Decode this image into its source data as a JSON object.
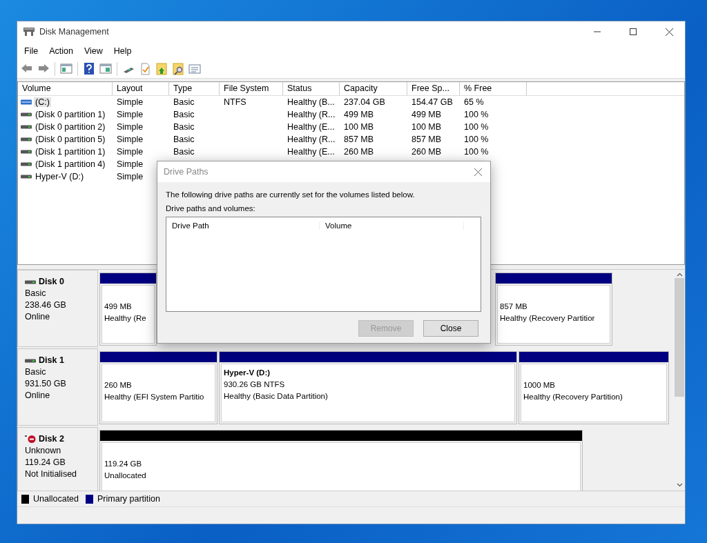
{
  "window": {
    "title": "Disk Management"
  },
  "menu": [
    "File",
    "Action",
    "View",
    "Help"
  ],
  "volume_table": {
    "columns": [
      "Volume",
      "Layout",
      "Type",
      "File System",
      "Status",
      "Capacity",
      "Free Sp...",
      "% Free"
    ],
    "rows": [
      {
        "kind": "system",
        "selected": true,
        "cells": [
          "(C:)",
          "Simple",
          "Basic",
          "NTFS",
          "Healthy (B...",
          "237.04 GB",
          "154.47 GB",
          "65 %"
        ]
      },
      {
        "kind": "plain",
        "selected": false,
        "cells": [
          "(Disk 0 partition 1)",
          "Simple",
          "Basic",
          "",
          "Healthy (R...",
          "499 MB",
          "499 MB",
          "100 %"
        ]
      },
      {
        "kind": "plain",
        "selected": false,
        "cells": [
          "(Disk 0 partition 2)",
          "Simple",
          "Basic",
          "",
          "Healthy (E...",
          "100 MB",
          "100 MB",
          "100 %"
        ]
      },
      {
        "kind": "plain",
        "selected": false,
        "cells": [
          "(Disk 0 partition 5)",
          "Simple",
          "Basic",
          "",
          "Healthy (R...",
          "857 MB",
          "857 MB",
          "100 %"
        ]
      },
      {
        "kind": "plain",
        "selected": false,
        "cells": [
          "(Disk 1 partition 1)",
          "Simple",
          "Basic",
          "",
          "Healthy (E...",
          "260 MB",
          "260 MB",
          "100 %"
        ]
      },
      {
        "kind": "plain",
        "selected": false,
        "cells": [
          "(Disk 1 partition 4)",
          "Simple"
        ]
      },
      {
        "kind": "plain",
        "selected": false,
        "cells": [
          "Hyper-V (D:)",
          "Simple"
        ]
      }
    ]
  },
  "disks": [
    {
      "name": "Disk 0",
      "kind": "online",
      "lines": [
        "Basic",
        "238.46 GB",
        "Online"
      ],
      "partitions": [
        {
          "kind": "primary",
          "lines": [
            "499 MB",
            "Healthy (Re"
          ]
        },
        {
          "kind": "primary",
          "lines": [
            "857 MB",
            "Healthy (Recovery Partitior"
          ]
        }
      ]
    },
    {
      "name": "Disk 1",
      "kind": "online",
      "lines": [
        "Basic",
        "931.50 GB",
        "Online"
      ],
      "partitions": [
        {
          "kind": "primary",
          "lines": [
            "260 MB",
            "Healthy (EFI System Partitio"
          ]
        },
        {
          "kind": "primary",
          "name": "Hyper-V  (D:)",
          "lines": [
            "930.26 GB NTFS",
            "Healthy (Basic Data Partition)"
          ]
        },
        {
          "kind": "primary",
          "lines": [
            "1000 MB",
            "Healthy (Recovery Partition)"
          ]
        }
      ]
    },
    {
      "name": "Disk 2",
      "kind": "error",
      "lines": [
        "Unknown",
        "119.24 GB",
        "Not Initialised"
      ],
      "partitions": [
        {
          "kind": "unallocated",
          "lines": [
            "119.24 GB",
            "Unallocated"
          ]
        }
      ]
    }
  ],
  "legend": [
    {
      "label": "Unallocated",
      "color": "#000000"
    },
    {
      "label": "Primary partition",
      "color": "#000080"
    }
  ],
  "dialog": {
    "title": "Drive Paths",
    "message": "The following drive paths are currently set for the volumes listed below.",
    "list_label": "Drive paths and volumes:",
    "columns": [
      "Drive Path",
      "Volume"
    ],
    "buttons": [
      {
        "label": "Remove",
        "disabled": true
      },
      {
        "label": "Close",
        "disabled": false
      }
    ]
  }
}
